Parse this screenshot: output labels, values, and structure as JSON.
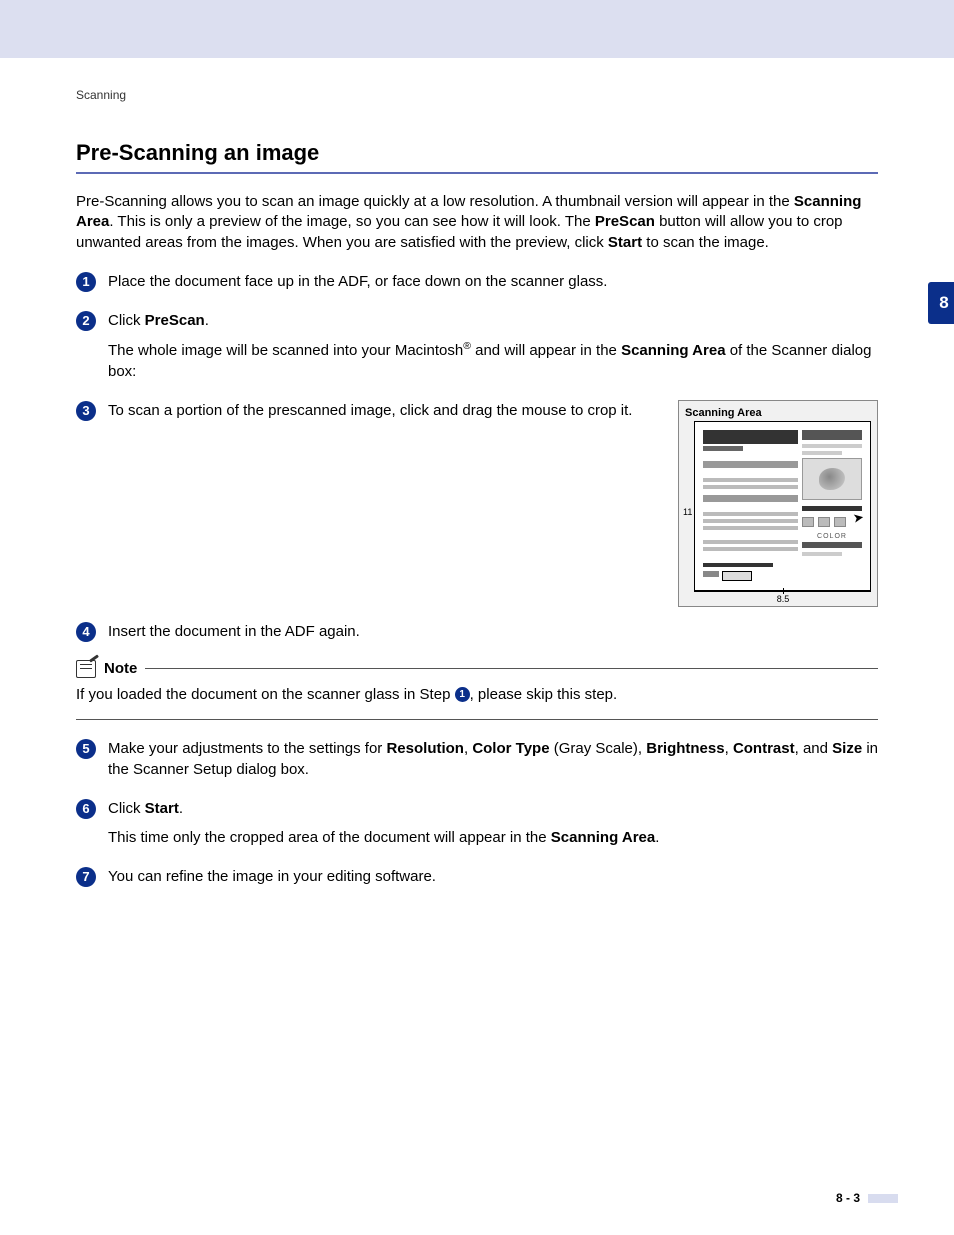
{
  "breadcrumb": "Scanning",
  "title": "Pre-Scanning an image",
  "side_tab": "8",
  "intro_1a": "Pre-Scanning allows you to scan an image quickly at a low resolution. A thumbnail version will appear in the ",
  "intro_1b": "Scanning Area",
  "intro_1c": ". This is only a preview of the image, so you can see how it will look. The ",
  "intro_1d": "PreScan",
  "intro_1e": " button will allow you to crop unwanted areas from the images. When you are satisfied with the preview, click ",
  "intro_1f": "Start",
  "intro_1g": " to scan the image.",
  "steps": {
    "s1": {
      "n": "1",
      "t1": "Place the document face up in the ADF, or face down on the scanner glass."
    },
    "s2": {
      "n": "2",
      "t1": "Click ",
      "b1": "PreScan",
      "t2": ".",
      "sub_a": "The whole image will be scanned into your Macintosh",
      "sub_b": " and will appear in the ",
      "sub_c": "Scanning Area",
      "sub_d": " of the Scanner dialog box:"
    },
    "s3": {
      "n": "3",
      "t1": "To scan a portion of the prescanned image, click and drag the mouse to crop it."
    },
    "s4": {
      "n": "4",
      "t1": "Insert the document in the ADF again."
    },
    "s5": {
      "n": "5",
      "t1": "Make your adjustments to the settings for ",
      "b1": "Resolution",
      "c1": ", ",
      "b2": "Color Type",
      "c2": " (Gray Scale), ",
      "b3": "Brightness",
      "c3": ", ",
      "b4": "Contrast",
      "c4": ", and ",
      "b5": "Size",
      "c5": " in the Scanner Setup dialog box."
    },
    "s6": {
      "n": "6",
      "t1": "Click ",
      "b1": "Start",
      "t2": ".",
      "sub_a": "This time only the cropped area of the document will appear in the ",
      "sub_b": "Scanning Area",
      "sub_c": "."
    },
    "s7": {
      "n": "7",
      "t1": "You can refine the image in your editing software."
    }
  },
  "note": {
    "title": "Note",
    "body_a": "If you loaded the document on the scanner glass in Step ",
    "body_ref": "1",
    "body_b": ", please skip this step."
  },
  "figure": {
    "title": "Scanning Area",
    "axis_y": "11",
    "axis_x": "8.5",
    "color_label": "COLOR"
  },
  "footer": "8 - 3"
}
